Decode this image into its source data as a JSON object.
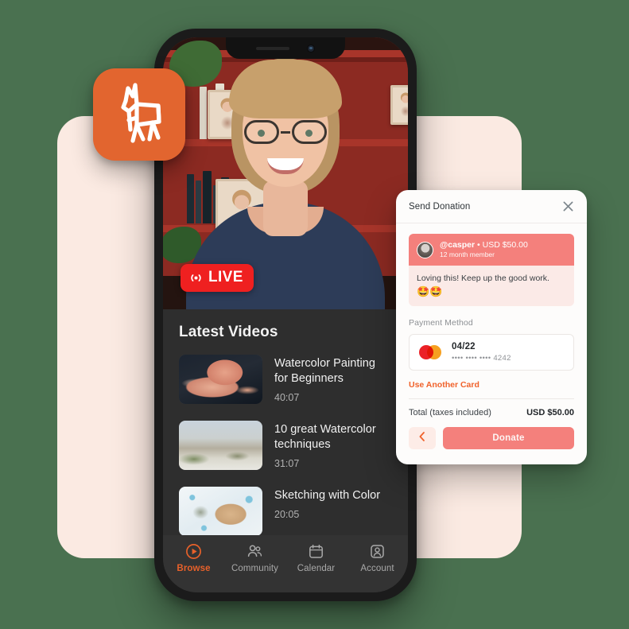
{
  "colors": {
    "background": "#4a7150",
    "panel_pink": "#fbeae2",
    "brand_orange": "#e2652f",
    "accent_coral": "#f4807c",
    "live_red": "#ef2020",
    "link_orange": "#f0622b"
  },
  "app_icon": {
    "name": "llama-logo",
    "background": "#e2652f"
  },
  "phone": {
    "stream": {
      "live_badge_label": "LIVE",
      "live_badge_icon": "broadcast-icon"
    },
    "videos": {
      "section_title": "Latest Videos",
      "items": [
        {
          "title": "Watercolor Painting for Beginners",
          "duration": "40:07",
          "thumbnail": "octopus-watercolor"
        },
        {
          "title": "10 great Watercolor techniques",
          "duration": "31:07",
          "thumbnail": "landscape-watercolor"
        },
        {
          "title": "Sketching with Color",
          "duration": "20:05",
          "thumbnail": "sea-turtle-watercolor"
        }
      ]
    },
    "tabbar": {
      "items": [
        {
          "label": "Browse",
          "icon": "play-circle-icon",
          "active": true
        },
        {
          "label": "Community",
          "icon": "people-icon",
          "active": false
        },
        {
          "label": "Calendar",
          "icon": "calendar-icon",
          "active": false
        },
        {
          "label": "Account",
          "icon": "person-card-icon",
          "active": false
        }
      ]
    }
  },
  "donation": {
    "title": "Send Donation",
    "close_icon": "close-icon",
    "message": {
      "username": "@casper",
      "separator": " • ",
      "amount": "USD $50.00",
      "membership": "12 month member",
      "text": "Loving this! Keep up the good work.",
      "emoji": "🤩🤩",
      "avatar": "user-avatar"
    },
    "payment_method_label": "Payment Method",
    "card": {
      "brand_icon": "mastercard-icon",
      "expiry": "04/22",
      "number": "•••• •••• •••• 4242"
    },
    "use_another_card_label": "Use Another Card",
    "total_label": "Total (taxes included)",
    "total_value": "USD $50.00",
    "back_icon": "chevron-left-icon",
    "donate_label": "Donate"
  }
}
